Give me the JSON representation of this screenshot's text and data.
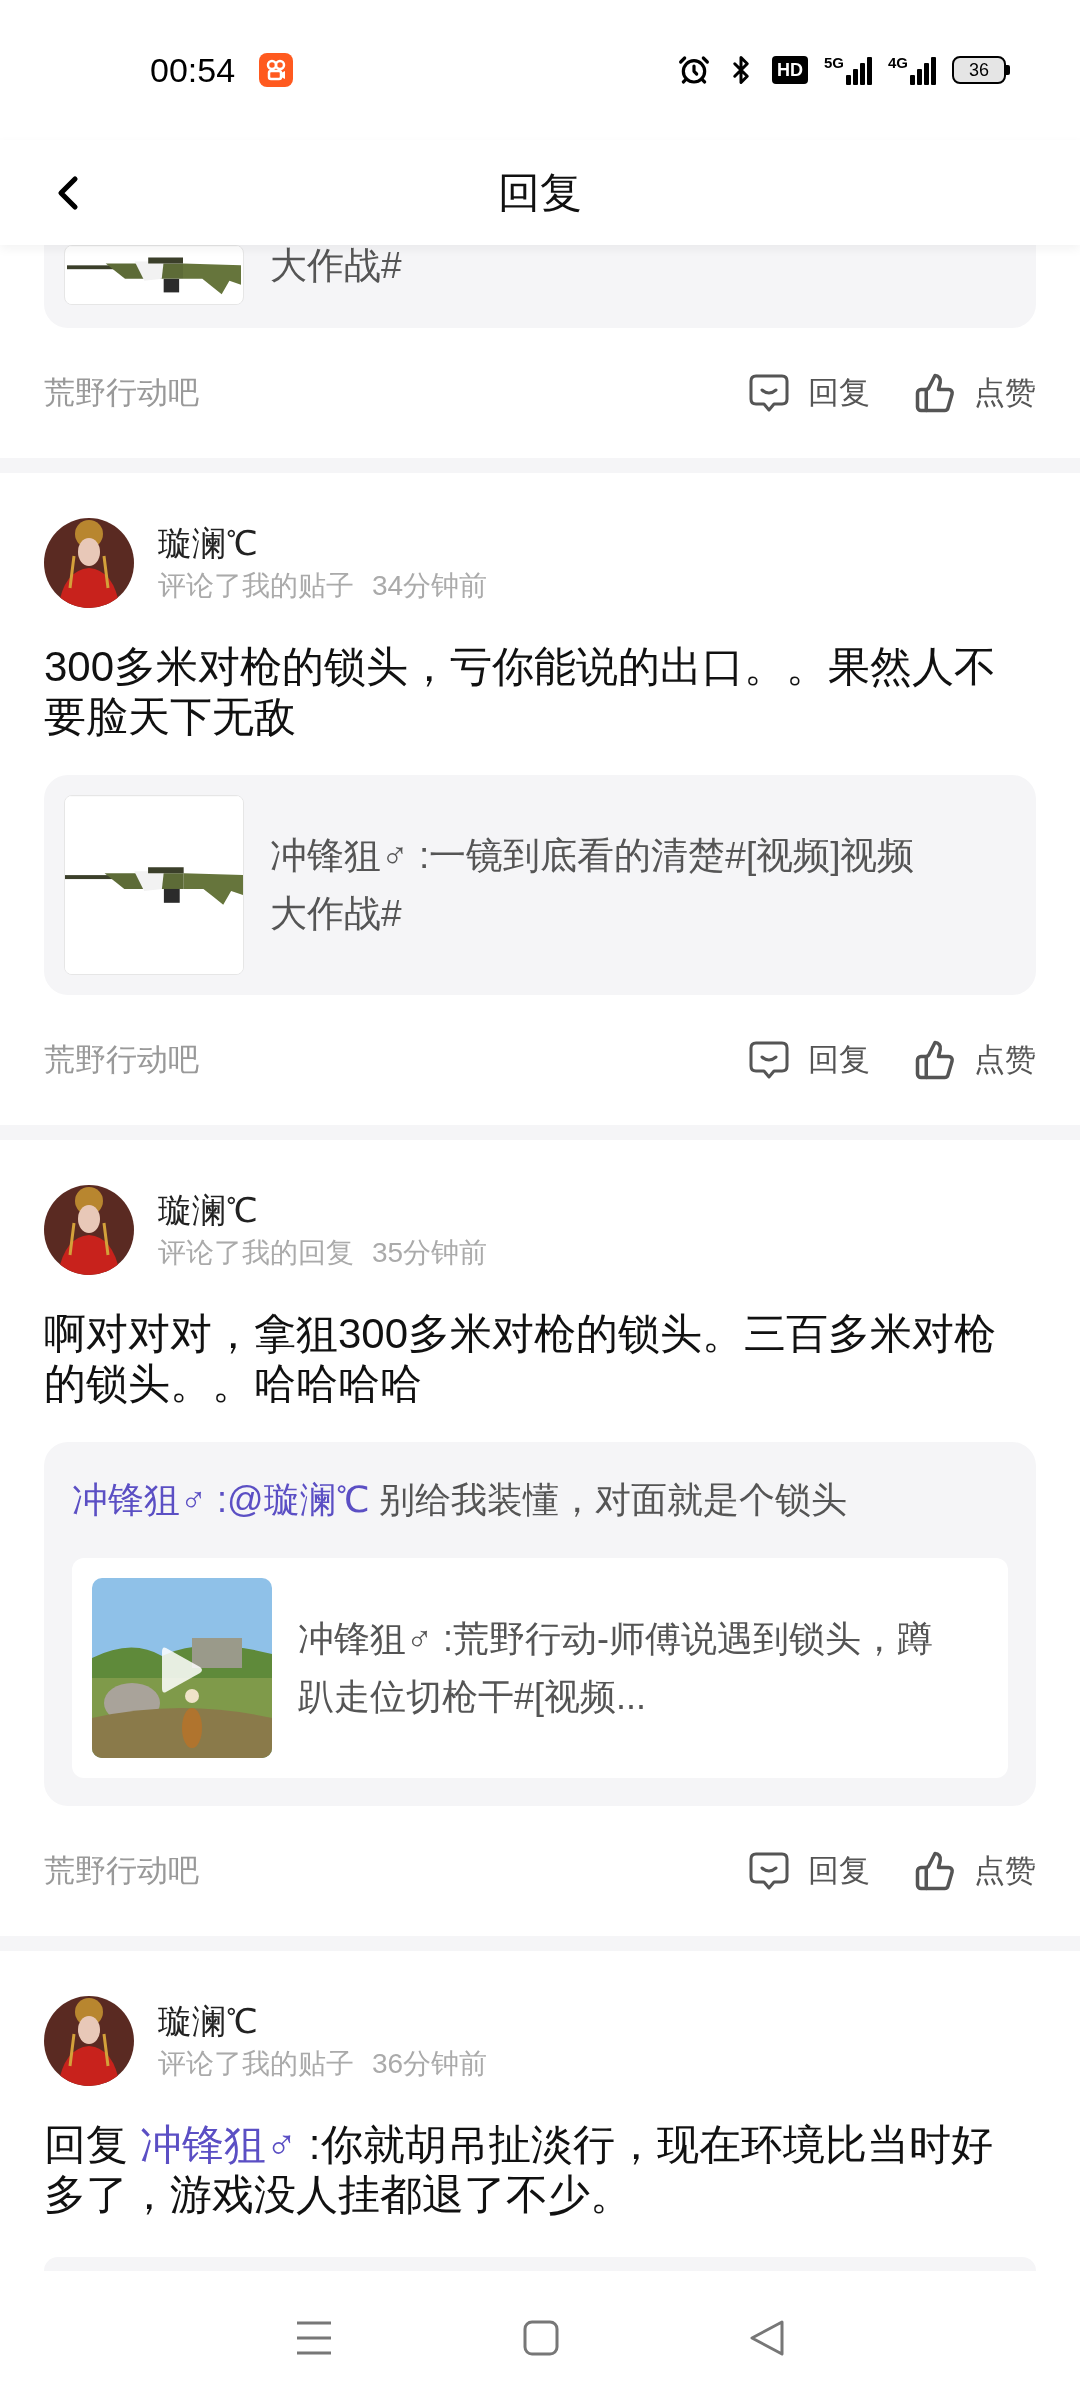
{
  "status_bar": {
    "time": "00:54",
    "hd": "HD",
    "network_1": "5G",
    "network_2": "4G",
    "battery": "36"
  },
  "header": {
    "title": "回复"
  },
  "posts": [
    {
      "partial": true,
      "quote": {
        "kind": "simple",
        "text": "大作战#"
      },
      "forum": "荒野行动吧",
      "actions": [
        {
          "kind": "reply",
          "label": "回复"
        },
        {
          "kind": "like",
          "label": "点赞"
        }
      ]
    },
    {
      "partial": false,
      "author": "璇澜℃",
      "action": "评论了我的贴子",
      "time": "34分钟前",
      "body": [
        {
          "kind": "plain",
          "text": "300多米对枪的锁头，亏你能说的出口。。果然人不要脸天下无敌"
        }
      ],
      "quote": {
        "kind": "simple",
        "text": "冲锋狙♂ :一镜到底看的清楚#[视频]视频大作战#"
      },
      "forum": "荒野行动吧",
      "actions": [
        {
          "kind": "reply",
          "label": "回复"
        },
        {
          "kind": "like",
          "label": "点赞"
        }
      ]
    },
    {
      "partial": false,
      "author": "璇澜℃",
      "action": "评论了我的回复",
      "time": "35分钟前",
      "body": [
        {
          "kind": "plain",
          "text": "啊对对对，拿狙300多米对枪的锁头。三百多米对枪的锁头。。哈哈哈哈"
        }
      ],
      "quote": {
        "kind": "nested",
        "author": "冲锋狙♂ :",
        "mention": "@璇澜℃",
        "text": "别给我装懂，对面就是个锁头",
        "inner": {
          "text": "冲锋狙♂ :荒野行动-师傅说遇到锁头，蹲趴走位切枪干#[视频..."
        }
      },
      "forum": "荒野行动吧",
      "actions": [
        {
          "kind": "reply",
          "label": "回复"
        },
        {
          "kind": "like",
          "label": "点赞"
        }
      ]
    },
    {
      "partial": false,
      "author": "璇澜℃",
      "action": "评论了我的贴子",
      "time": "36分钟前",
      "body": [
        {
          "kind": "plain",
          "text": "回复 "
        },
        {
          "kind": "mention",
          "text": "冲锋狙♂"
        },
        {
          "kind": "plain",
          "text": " :你就胡吊扯淡行，现在环境比当时好多了，游戏没人挂都退了不少。"
        }
      ],
      "quote": {
        "kind": "cut"
      }
    }
  ]
}
